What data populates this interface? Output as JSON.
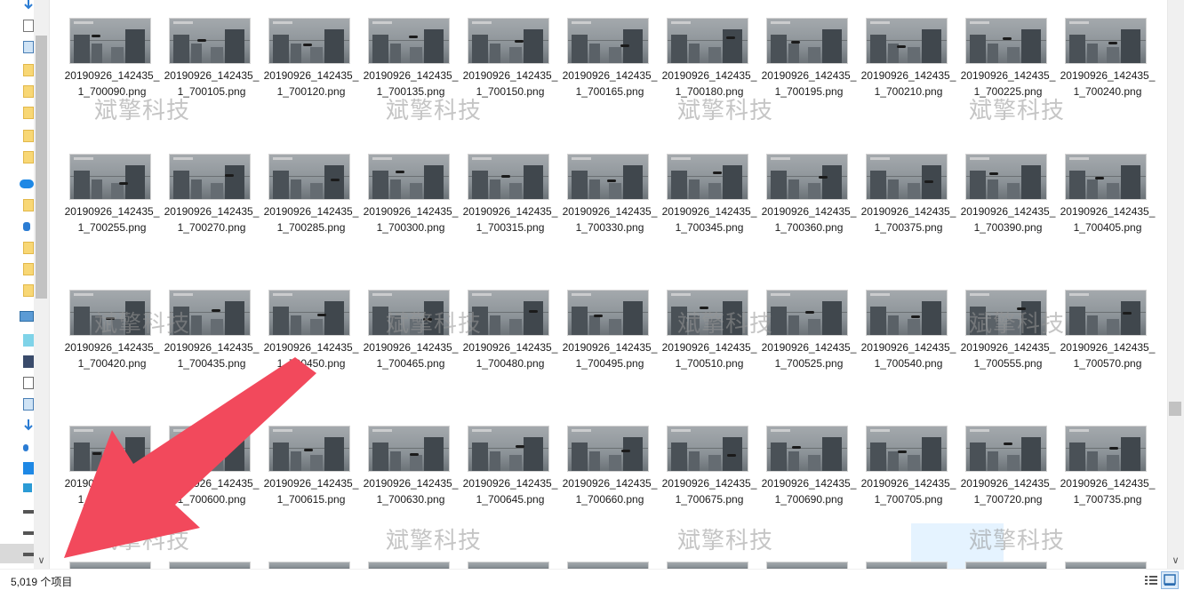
{
  "files": [
    "20190926_142435_1_700090.png",
    "20190926_142435_1_700105.png",
    "20190926_142435_1_700120.png",
    "20190926_142435_1_700135.png",
    "20190926_142435_1_700150.png",
    "20190926_142435_1_700165.png",
    "20190926_142435_1_700180.png",
    "20190926_142435_1_700195.png",
    "20190926_142435_1_700210.png",
    "20190926_142435_1_700225.png",
    "20190926_142435_1_700240.png",
    "20190926_142435_1_700255.png",
    "20190926_142435_1_700270.png",
    "20190926_142435_1_700285.png",
    "20190926_142435_1_700300.png",
    "20190926_142435_1_700315.png",
    "20190926_142435_1_700330.png",
    "20190926_142435_1_700345.png",
    "20190926_142435_1_700360.png",
    "20190926_142435_1_700375.png",
    "20190926_142435_1_700390.png",
    "20190926_142435_1_700405.png",
    "20190926_142435_1_700420.png",
    "20190926_142435_1_700435.png",
    "20190926_142435_1_700450.png",
    "20190926_142435_1_700465.png",
    "20190926_142435_1_700480.png",
    "20190926_142435_1_700495.png",
    "20190926_142435_1_700510.png",
    "20190926_142435_1_700525.png",
    "20190926_142435_1_700540.png",
    "20190926_142435_1_700555.png",
    "20190926_142435_1_700570.png",
    "20190926_142435_1_700585.png",
    "20190926_142435_1_700600.png",
    "20190926_142435_1_700615.png",
    "20190926_142435_1_700630.png",
    "20190926_142435_1_700645.png",
    "20190926_142435_1_700660.png",
    "20190926_142435_1_700675.png",
    "20190926_142435_1_700690.png",
    "20190926_142435_1_700705.png",
    "20190926_142435_1_700720.png",
    "20190926_142435_1_700735.png"
  ],
  "watermark": "斌擎科技",
  "status": {
    "item_count": "5,019 个项目"
  },
  "icons": {
    "nav_scroll_down": "chevron-down-icon",
    "v_scroll_down": "chevron-down-icon",
    "details_view": "details-view-icon",
    "large_icons_view": "large-icons-view-icon"
  },
  "colors": {
    "selection": "#e5f3ff",
    "arrow": "#f2495c",
    "folder": "#f8d775"
  }
}
